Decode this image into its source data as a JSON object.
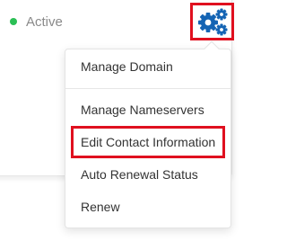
{
  "status": {
    "label": "Active",
    "dot_color": "#2bbf55"
  },
  "actions_button": {
    "icon": "gears-icon",
    "icon_color": "#1464b4",
    "highlight_color": "#e0101f"
  },
  "menu": {
    "items": [
      {
        "label": "Manage Domain"
      },
      {
        "label": "Manage Nameservers"
      },
      {
        "label": "Edit Contact Information",
        "highlighted": true
      },
      {
        "label": "Auto Renewal Status"
      },
      {
        "label": "Renew"
      }
    ]
  }
}
